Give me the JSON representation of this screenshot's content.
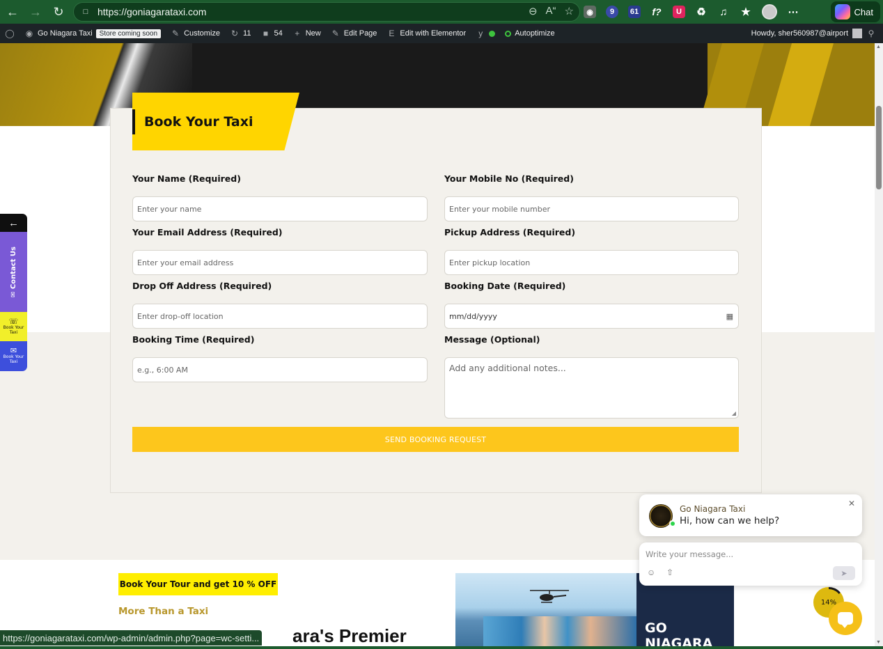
{
  "browser": {
    "url": "https://goniagarataxi.com",
    "chat_label": "Chat",
    "extension_badges": [
      "9",
      "61"
    ],
    "fx_label": "f?"
  },
  "wp_admin_bar": {
    "site_name": "Go Niagara Taxi",
    "store_badge": "Store coming soon",
    "customize": "Customize",
    "updates_count": "11",
    "comments_count": "54",
    "new_label": "New",
    "edit_page": "Edit Page",
    "edit_elementor": "Edit with Elementor",
    "autoptimize": "Autoptimize",
    "howdy": "Howdy, sher560987@airport"
  },
  "form": {
    "title": "Book Your Taxi",
    "fields": {
      "name": {
        "label": "Your Name (Required)",
        "placeholder": "Enter your name"
      },
      "mobile": {
        "label": "Your Mobile No (Required)",
        "placeholder": "Enter your mobile number"
      },
      "email": {
        "label": "Your Email Address (Required)",
        "placeholder": "Enter your email address"
      },
      "pickup": {
        "label": "Pickup Address (Required)",
        "placeholder": "Enter pickup location"
      },
      "dropoff": {
        "label": "Drop Off Address (Required)",
        "placeholder": "Enter drop-off location"
      },
      "date": {
        "label": "Booking Date (Required)",
        "placeholder": "mm/dd/yyyy"
      },
      "time": {
        "label": "Booking Time (Required)",
        "placeholder": "e.g., 6:00 AM"
      },
      "message": {
        "label": "Message (Optional)",
        "placeholder": "Add any additional notes..."
      }
    },
    "submit_label": "SEND BOOKING REQUEST"
  },
  "side_widget": {
    "contact_label": "Contact Us",
    "whatsapp_label": "Book Your Taxi",
    "email_label": "Book Your Taxi"
  },
  "lower_section": {
    "promo_button": "Book Your Tour and get 10 % OFF",
    "subtitle": "More Than a Taxi",
    "heading": "ara's Premier",
    "tour_panel_text": "GO NIAGARA TOUR"
  },
  "chat_widget": {
    "business_name": "Go Niagara Taxi",
    "greeting": "Hi, how can we help?",
    "input_placeholder": "Write your message...",
    "progress_label": "14%",
    "progress_fraction": 0.14
  },
  "status_bar": {
    "link": "https://goniagarataxi.com/wp-admin/admin.php?page=wc-setti..."
  },
  "colors": {
    "accent_yellow": "#ffd500",
    "submit_yellow": "#fdc61c",
    "browser_green": "#1c5b2e",
    "wp_bar": "#1d2327",
    "contact_purple": "#7a59d6",
    "whatsapp_yellow": "#f1ef2a",
    "email_blue": "#3d4fdc"
  }
}
